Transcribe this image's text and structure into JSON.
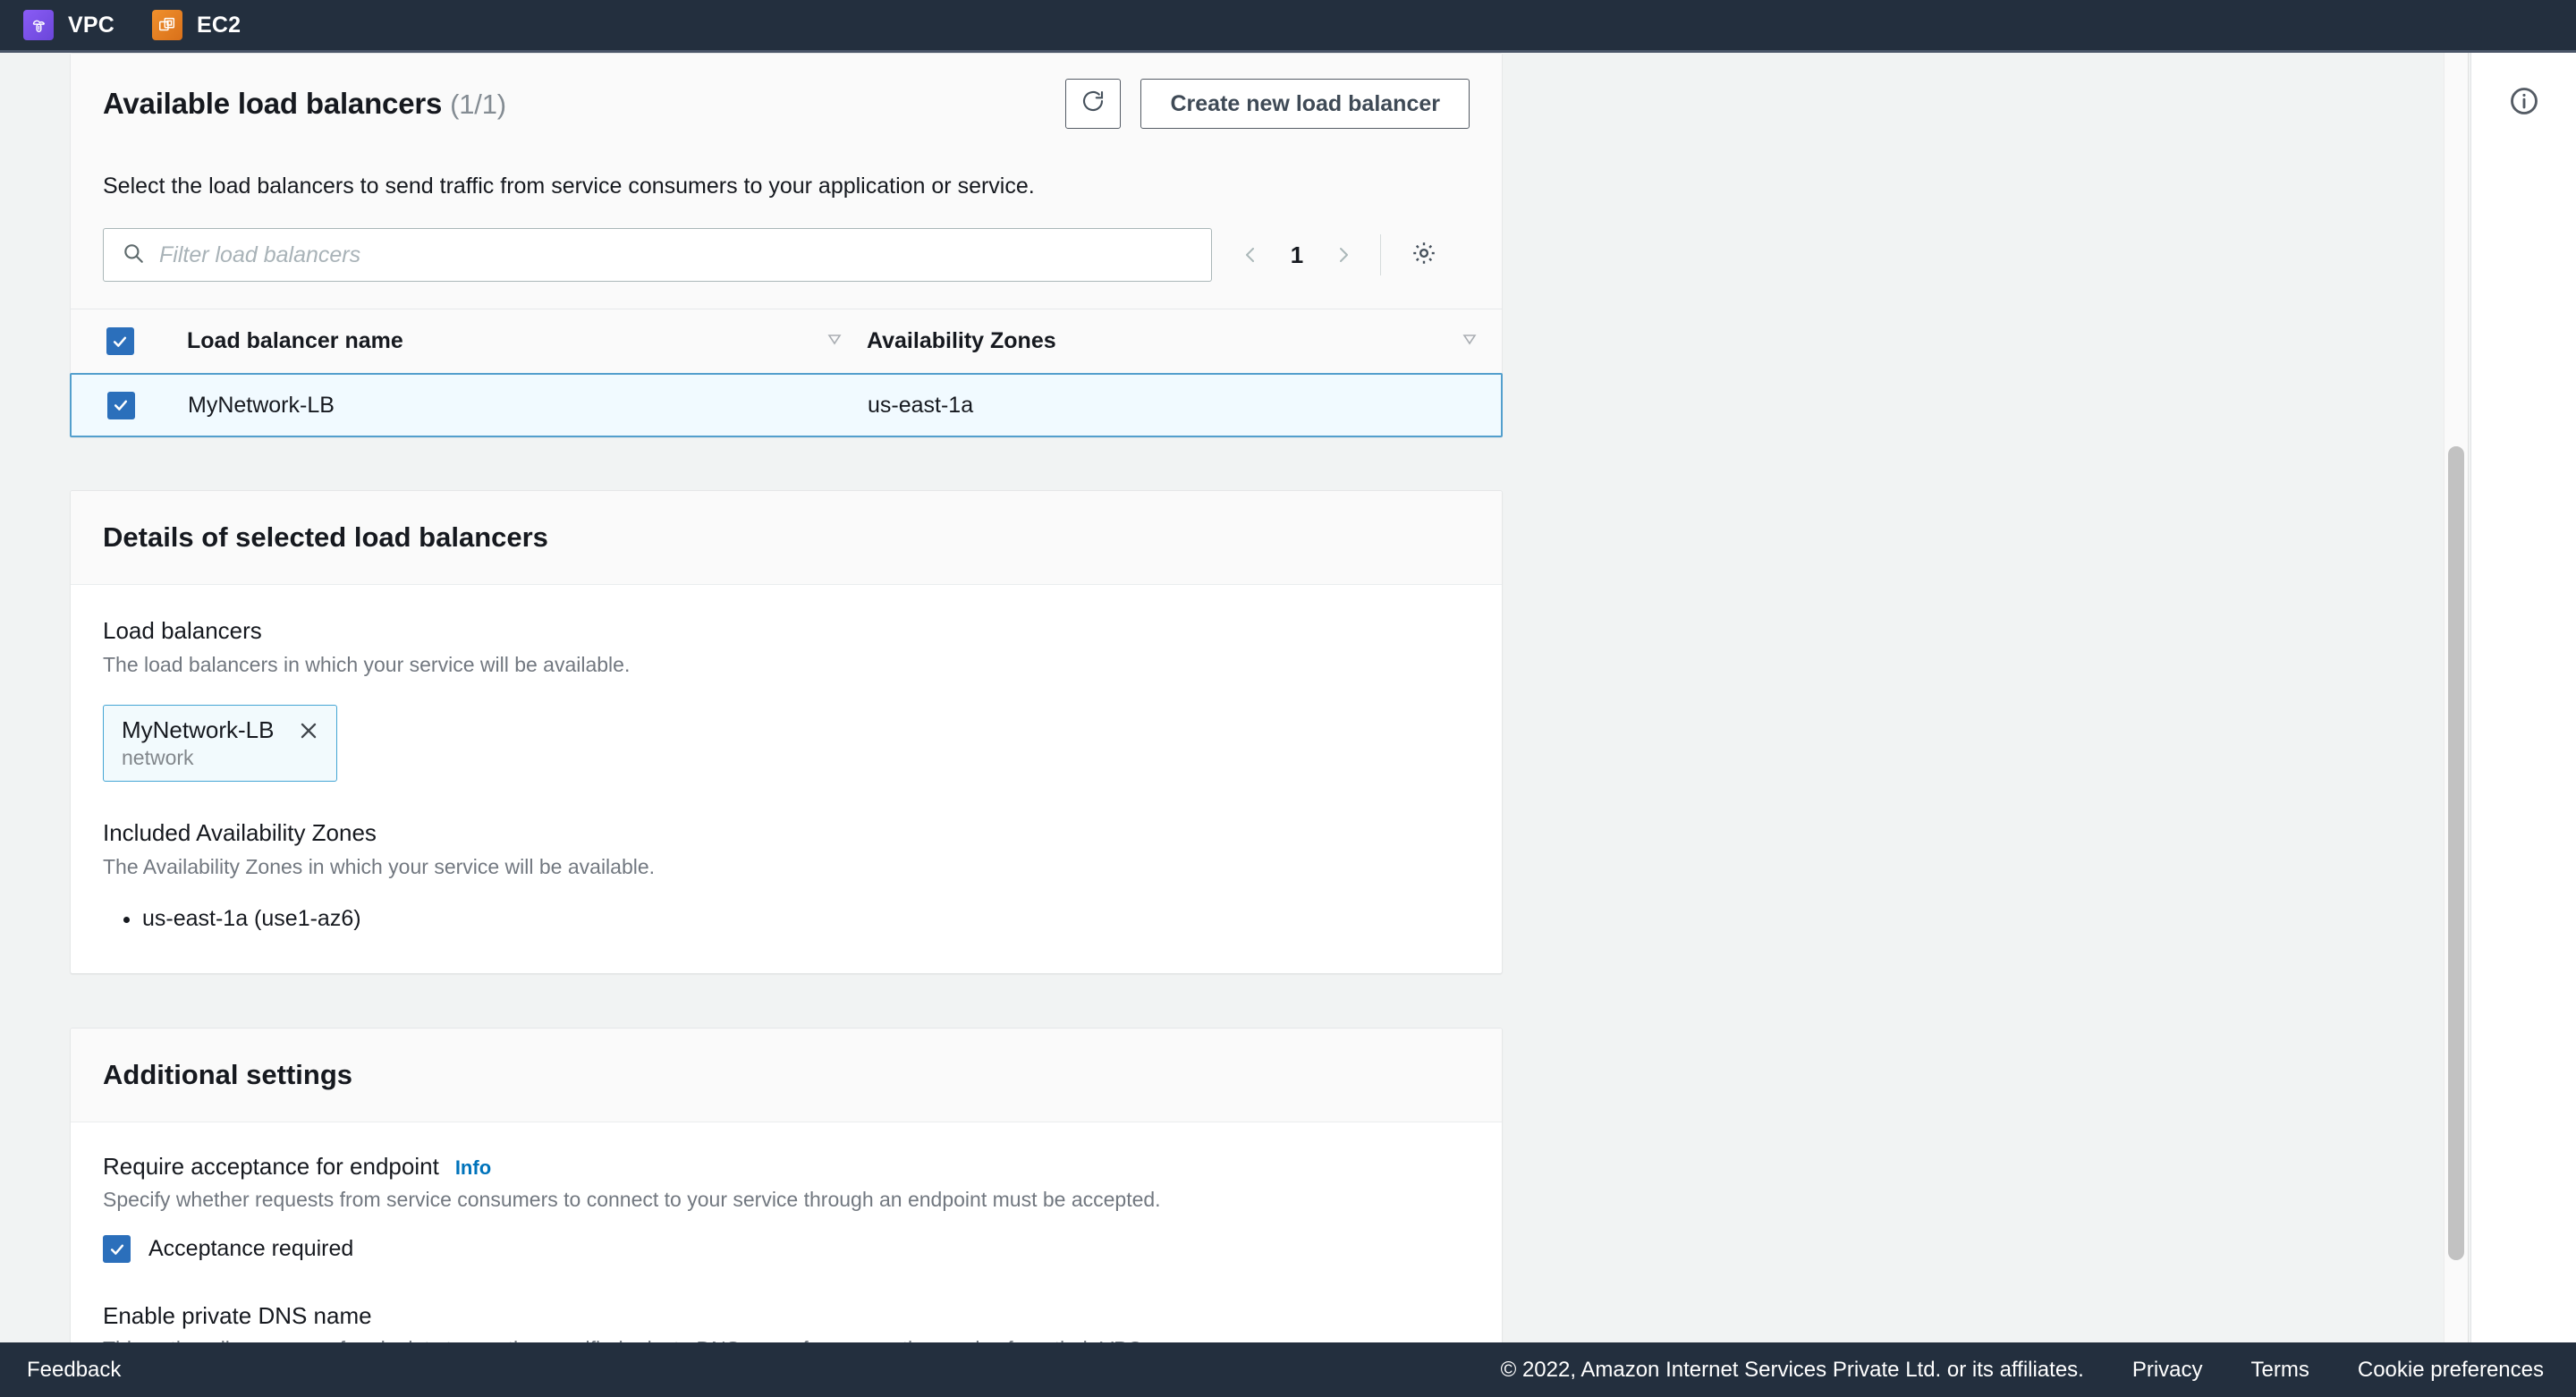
{
  "topnav": {
    "tabs": [
      {
        "label": "VPC",
        "icon": "vpc-cloud-icon"
      },
      {
        "label": "EC2",
        "icon": "ec2-instances-icon"
      }
    ]
  },
  "load_balancers_panel": {
    "title": "Available load balancers",
    "count": "(1/1)",
    "description": "Select the load balancers to send traffic from service consumers to your application or service.",
    "refresh_label": "",
    "create_button": "Create new load balancer",
    "search_placeholder": "Filter load balancers",
    "search_value": "",
    "pagination": {
      "current_page": "1"
    },
    "table": {
      "columns": [
        "Load balancer name",
        "Availability Zones"
      ],
      "rows": [
        {
          "name": "MyNetwork-LB",
          "az": "us-east-1a",
          "selected": true
        }
      ],
      "header_checkbox_checked": true
    }
  },
  "details_panel": {
    "title": "Details of selected load balancers",
    "load_balancers": {
      "label": "Load balancers",
      "description": "The load balancers in which your service will be available.",
      "tokens": [
        {
          "name": "MyNetwork-LB",
          "type": "network"
        }
      ]
    },
    "availability_zones": {
      "label": "Included Availability Zones",
      "description": "The Availability Zones in which your service will be available.",
      "items": [
        "us-east-1a (use1-az6)"
      ]
    }
  },
  "additional_settings": {
    "title": "Additional settings",
    "require_acceptance": {
      "label": "Require acceptance for endpoint",
      "info_link": "Info",
      "description": "Specify whether requests from service consumers to connect to your service through an endpoint must be accepted.",
      "checkbox_label": "Acceptance required",
      "checked": true
    },
    "private_dns": {
      "label": "Enable private DNS name",
      "description": "This option allows users of endpoints to use the specified private DNS name for access the service from their VPCs."
    }
  },
  "footer": {
    "feedback": "Feedback",
    "copyright": "© 2022, Amazon Internet Services Private Ltd. or its affiliates.",
    "links": [
      "Privacy",
      "Terms",
      "Cookie preferences"
    ]
  },
  "colors": {
    "nav_bg": "#232f3e",
    "accent_blue": "#0073bb",
    "checkbox_blue": "#2b6fbb",
    "selected_row_bg": "#f1faff",
    "selected_row_border": "#539fcd",
    "page_bg": "#f1f3f3"
  }
}
